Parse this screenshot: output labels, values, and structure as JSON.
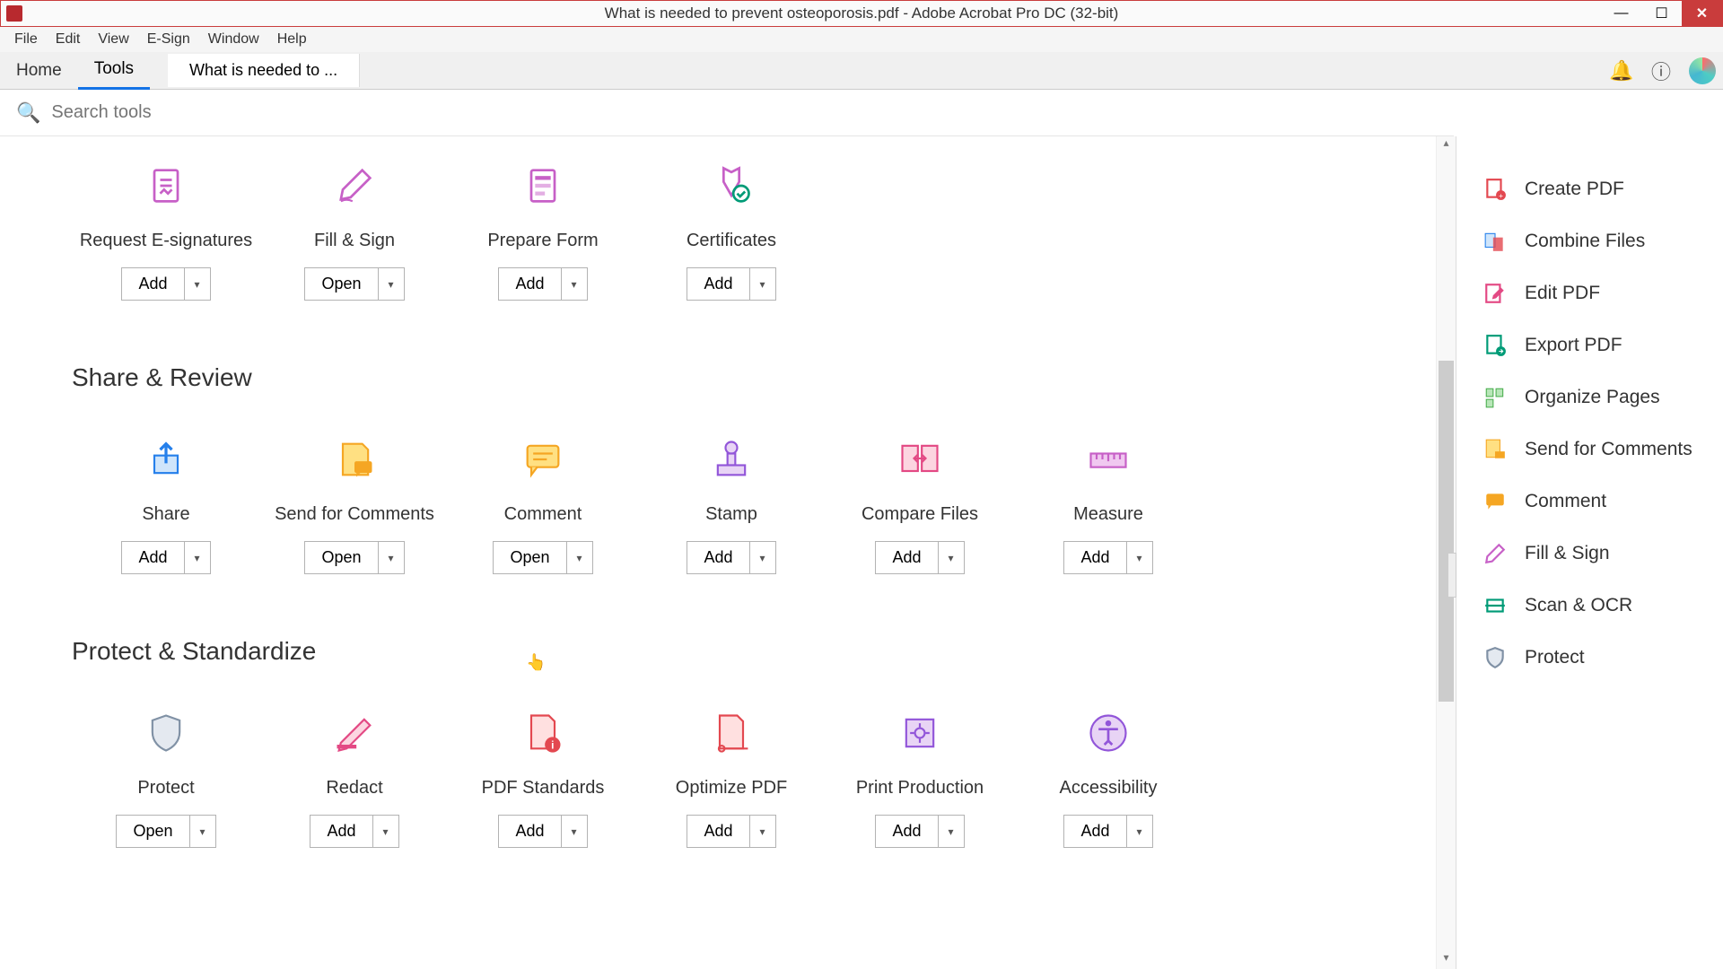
{
  "title": "What is needed to prevent osteoporosis.pdf - Adobe Acrobat Pro DC (32-bit)",
  "menu": [
    "File",
    "Edit",
    "View",
    "E-Sign",
    "Window",
    "Help"
  ],
  "tabs": {
    "home": "Home",
    "tools": "Tools",
    "doc": "What is needed to ..."
  },
  "search": {
    "placeholder": "Search tools"
  },
  "sections": [
    {
      "title": "",
      "tools": [
        {
          "label": "Request E-signatures",
          "btn": "Add"
        },
        {
          "label": "Fill & Sign",
          "btn": "Open"
        },
        {
          "label": "Prepare Form",
          "btn": "Add"
        },
        {
          "label": "Certificates",
          "btn": "Add"
        }
      ]
    },
    {
      "title": "Share & Review",
      "tools": [
        {
          "label": "Share",
          "btn": "Add"
        },
        {
          "label": "Send for Comments",
          "btn": "Open"
        },
        {
          "label": "Comment",
          "btn": "Open"
        },
        {
          "label": "Stamp",
          "btn": "Add"
        },
        {
          "label": "Compare Files",
          "btn": "Add"
        },
        {
          "label": "Measure",
          "btn": "Add"
        }
      ]
    },
    {
      "title": "Protect & Standardize",
      "tools": [
        {
          "label": "Protect",
          "btn": "Open"
        },
        {
          "label": "Redact",
          "btn": "Add"
        },
        {
          "label": "PDF Standards",
          "btn": "Add"
        },
        {
          "label": "Optimize PDF",
          "btn": "Add"
        },
        {
          "label": "Print Production",
          "btn": "Add"
        },
        {
          "label": "Accessibility",
          "btn": "Add"
        }
      ]
    }
  ],
  "sidebar": [
    "Create PDF",
    "Combine Files",
    "Edit PDF",
    "Export PDF",
    "Organize Pages",
    "Send for Comments",
    "Comment",
    "Fill & Sign",
    "Scan & OCR",
    "Protect"
  ]
}
